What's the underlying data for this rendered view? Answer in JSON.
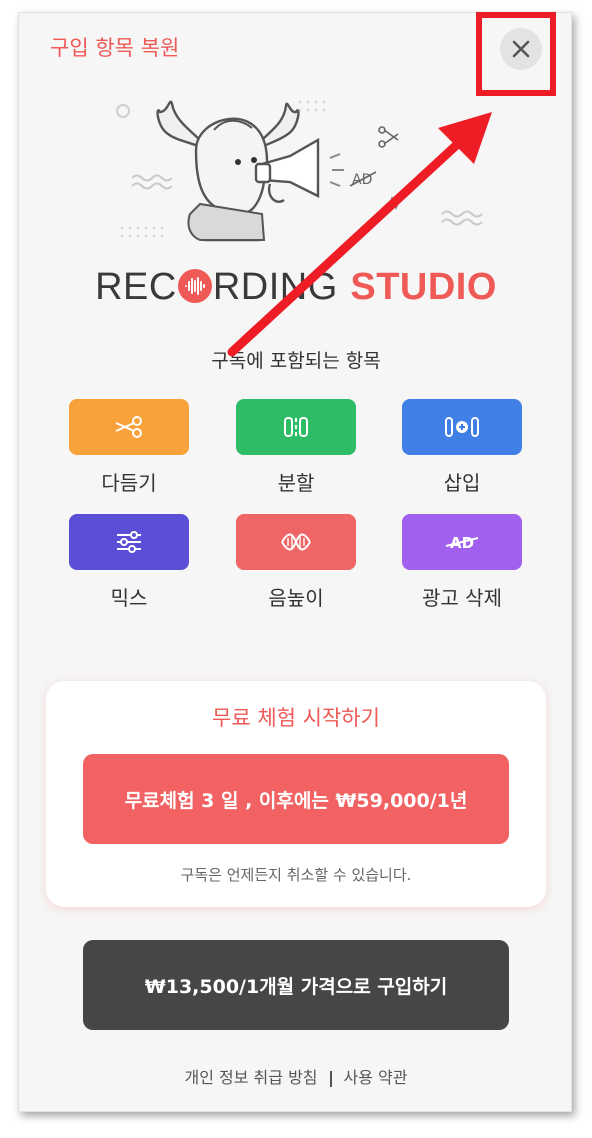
{
  "header": {
    "restore_label": "구입 항목 복원",
    "close_symbol": "✕"
  },
  "logo": {
    "part1": "REC",
    "part2": "RDING",
    "part3": "STUDIO"
  },
  "subtitle": "구독에 포함되는 항목",
  "features": [
    {
      "label": "다듬기",
      "icon": "scissors-icon",
      "color": "#f9a13a"
    },
    {
      "label": "분할",
      "icon": "split-icon",
      "color": "#2ebc67"
    },
    {
      "label": "삽입",
      "icon": "insert-icon",
      "color": "#3f7fe6"
    },
    {
      "label": "믹스",
      "icon": "mix-sliders-icon",
      "color": "#5a4fd6"
    },
    {
      "label": "음높이",
      "icon": "pitch-wave-icon",
      "color": "#f06565"
    },
    {
      "label": "광고 삭제",
      "icon": "ad-remove-icon",
      "color": "#a160ee",
      "icon_text": "AD"
    }
  ],
  "trial": {
    "title": "무료 체험 시작하기",
    "button_label": "무료체험 3 일 , 이후에는 ₩59,000/1년",
    "note": "구독은 언제든지 취소할 수 있습니다."
  },
  "purchase": {
    "button_label": "₩13,500/1개월 가격으로 구입하기"
  },
  "footer": {
    "privacy_label": "개인 정보 취급 방침",
    "terms_label": "사용 약관"
  },
  "illustration": {
    "ad_text": "AD"
  },
  "colors": {
    "accent": "#ef5a56",
    "annotation": "#ee1c25",
    "dark_button": "#464548"
  }
}
